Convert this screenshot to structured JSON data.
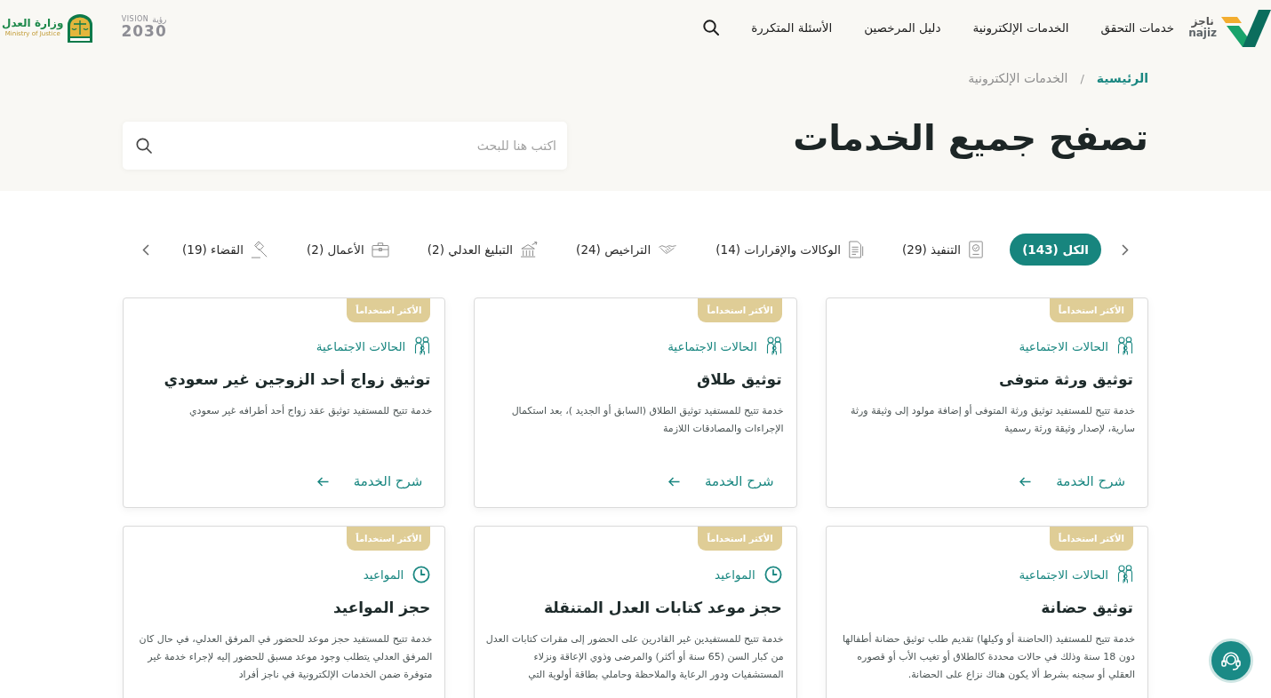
{
  "header": {
    "logo": {
      "name_ar": "ناجز",
      "name_en": "najiz"
    },
    "nav": [
      "خدمات التحقق",
      "الخدمات الإلكترونية",
      "دليل المرخصين",
      "الأسئلة المتكررة"
    ],
    "vision_logo": {
      "word_ar": "رؤية",
      "word_en": "VISION",
      "year": "2030"
    },
    "ministry_logo": {
      "name_ar": "وزارة العدل",
      "name_en": "Ministry of Justice"
    }
  },
  "breadcrumb": {
    "separator": "/",
    "items": [
      {
        "label": "الرئيسية",
        "current": false
      },
      {
        "label": "الخدمات الإلكترونية",
        "current": true
      }
    ]
  },
  "hero": {
    "title": "تصفح جميع الخدمات",
    "search": {
      "placeholder": "اكتب هنا للبحث"
    }
  },
  "tabs": [
    {
      "label": "الكل (143)",
      "selected": true
    },
    {
      "label": "التنفيذ (29)",
      "selected": false
    },
    {
      "label": "الوكالات والإقرارات (14)",
      "selected": false
    },
    {
      "label": "التراخيص (24)",
      "selected": false
    },
    {
      "label": "التبليغ العدلي (2)",
      "selected": false
    },
    {
      "label": "الأعمال (2)",
      "selected": false
    },
    {
      "label": "القضاء (19)",
      "selected": false
    }
  ],
  "cards": [
    {
      "badge": "الأكثر استخداماً",
      "category": {
        "label": "الحالات الاجتماعية",
        "kind": "social"
      },
      "title": "توثيق ورثة متوفى",
      "description": "خدمة تتيح للمستفيد توثيق ورثة المتوفى أو إضافة مولود إلى وثيقة ورثة سارية، لإصدار وثيقة ورثة رسمية",
      "link": "شرح الخدمة"
    },
    {
      "badge": "الأكثر استخداماً",
      "category": {
        "label": "الحالات الاجتماعية",
        "kind": "social"
      },
      "title": "توثيق طلاق",
      "description": "خدمة تتيح للمستفيد توثيق الطلاق (السابق أو الجديد )، بعد استكمال الإجراءات والمصادقات اللازمة",
      "link": "شرح الخدمة"
    },
    {
      "badge": "الأكثر استخداماً",
      "category": {
        "label": "الحالات الاجتماعية",
        "kind": "social"
      },
      "title": "توثيق زواج أحد الزوجين غير سعودي",
      "description": "خدمة تتيح للمستفيد توثيق عقد زواج أحد أطرافه غير سعودي",
      "link": "شرح الخدمة"
    },
    {
      "badge": "الأكثر استخداماً",
      "category": {
        "label": "الحالات الاجتماعية",
        "kind": "social"
      },
      "title": "توثيق حضانة",
      "description": "خدمة تتيح للمستفيد (الحاضنة أو وكيلها) تقديم طلب توثيق حضانة أطفالها دون 18 سنة وذلك في حالات محددة كالطلاق أو تغيب الأب أو قصوره العقلي أو سجنه بشرط ألا يكون هناك نزاع على الحضانة."
    },
    {
      "badge": "الأكثر استخداماً",
      "category": {
        "label": "المواعيد",
        "kind": "appointments"
      },
      "title": "حجز موعد كتابات العدل المتنقلة",
      "description": "خدمة تتيح للمستفيدين غير القادرين على الحضور إلى مقرات كتابات العدل من كبار السن (65 سنة أو أكثر) والمرضى وذوي الإعاقة ونزلاء المستشفيات ودور الرعاية والملاحظة وحاملي بطاقة أولوية التي"
    },
    {
      "badge": "الأكثر استخداماً",
      "category": {
        "label": "المواعيد",
        "kind": "appointments"
      },
      "title": "حجز المواعيد",
      "description": "خدمة تتيح للمستفيد حجز موعد للحضور في المرفق العدلي، في حال كان المرفق العدلي يتطلب وجود موعد مسبق للحضور إليه لإجراء خدمة غير متوفرة ضمن الخدمات الإلكترونية في ناجز أفراد"
    }
  ]
}
